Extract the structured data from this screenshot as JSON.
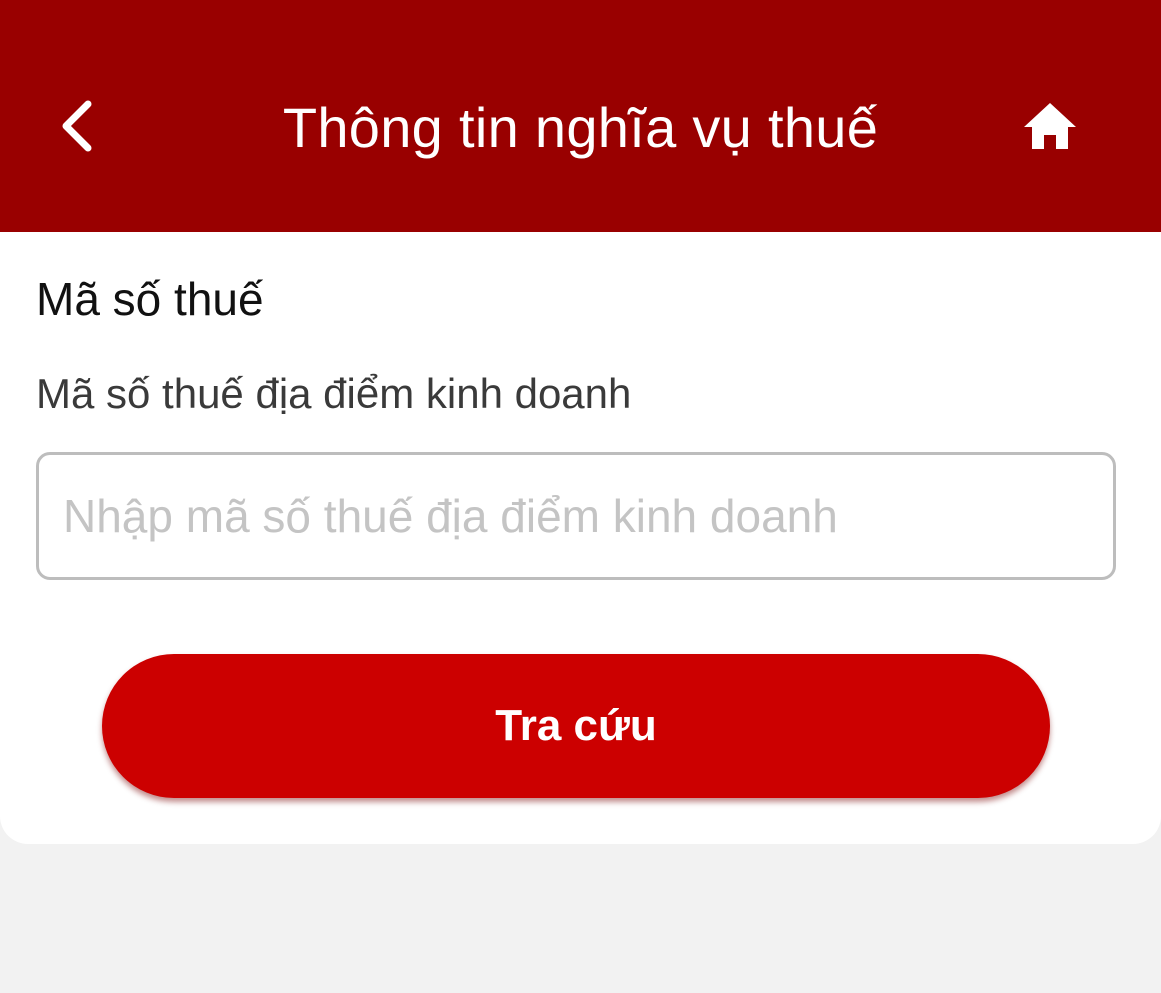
{
  "header": {
    "title": "Thông tin nghĩa vụ thuế",
    "back_icon": "chevron-left-icon",
    "home_icon": "home-icon",
    "background_color": "#990000"
  },
  "form": {
    "section_title": "Mã số thuế",
    "field_label": "Mã số thuế địa điểm kinh doanh",
    "input_value": "",
    "input_placeholder": "Nhập mã số thuế địa điểm kinh doanh",
    "submit_label": "Tra cứu",
    "button_color": "#cc0000"
  }
}
